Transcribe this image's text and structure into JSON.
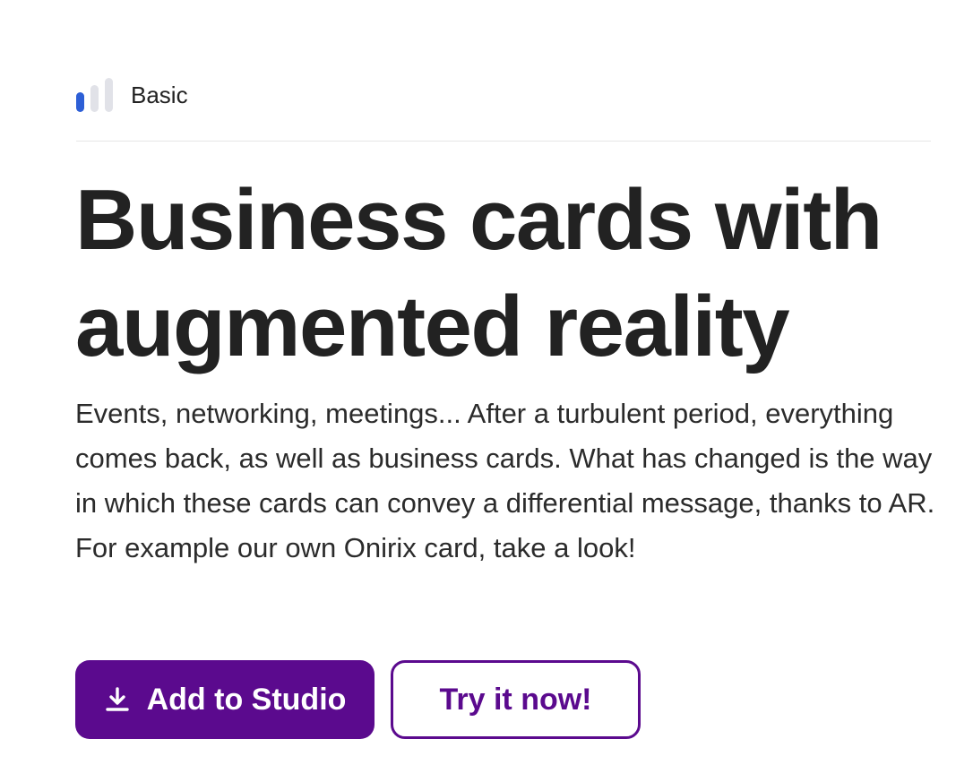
{
  "level": {
    "label": "Basic",
    "filled_bars": 1,
    "total_bars": 3,
    "active_color": "#2d5fd6",
    "inactive_color": "#e1e2e8"
  },
  "hero": {
    "title": "Business cards with augmented reality",
    "description": "Events, networking, meetings... After a turbulent period, everything comes back, as well as business cards. What has changed is the way in which these cards can convey a differential message, thanks to AR. For example our own Onirix card, take a look!"
  },
  "actions": {
    "primary": {
      "label": "Add to Studio",
      "icon": "download-icon"
    },
    "secondary": {
      "label": "Try it now!"
    }
  },
  "colors": {
    "brand": "#5b0a8e",
    "text": "#222222"
  }
}
